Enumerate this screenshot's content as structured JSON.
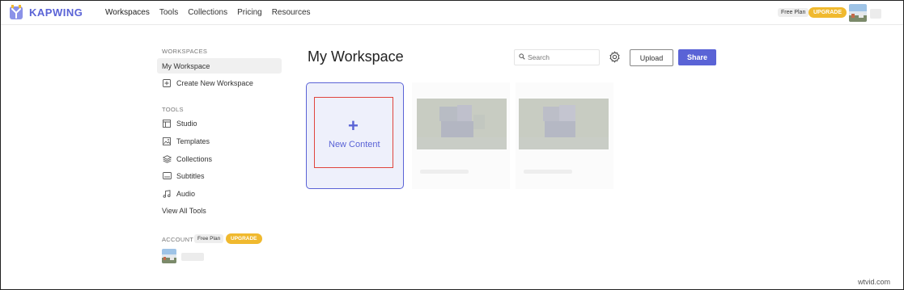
{
  "brand": {
    "name": "KAPWING",
    "color": "#5a63d6"
  },
  "nav": {
    "links": [
      "Workspaces",
      "Tools",
      "Collections",
      "Pricing",
      "Resources"
    ],
    "free_plan": "Free Plan",
    "upgrade": "UPGRADE"
  },
  "sidebar": {
    "workspaces_heading": "WORKSPACES",
    "my_workspace": "My Workspace",
    "create_workspace": "Create New Workspace",
    "tools_heading": "TOOLS",
    "tools": [
      {
        "label": "Studio",
        "icon": "studio-icon"
      },
      {
        "label": "Templates",
        "icon": "templates-icon"
      },
      {
        "label": "Collections",
        "icon": "collections-icon"
      },
      {
        "label": "Subtitles",
        "icon": "subtitles-icon"
      },
      {
        "label": "Audio",
        "icon": "audio-icon"
      }
    ],
    "view_all": "View All Tools",
    "account_heading": "ACCOUNT",
    "account_free_plan": "Free Plan",
    "account_upgrade": "UPGRADE"
  },
  "main": {
    "title": "My Workspace",
    "search_placeholder": "Search",
    "upload_label": "Upload",
    "share_label": "Share",
    "new_content_label": "New Content"
  },
  "watermark": "wtvid.com",
  "colors": {
    "accent": "#5a63d6",
    "upgrade": "#f0b92e",
    "highlight": "#e0453d"
  }
}
